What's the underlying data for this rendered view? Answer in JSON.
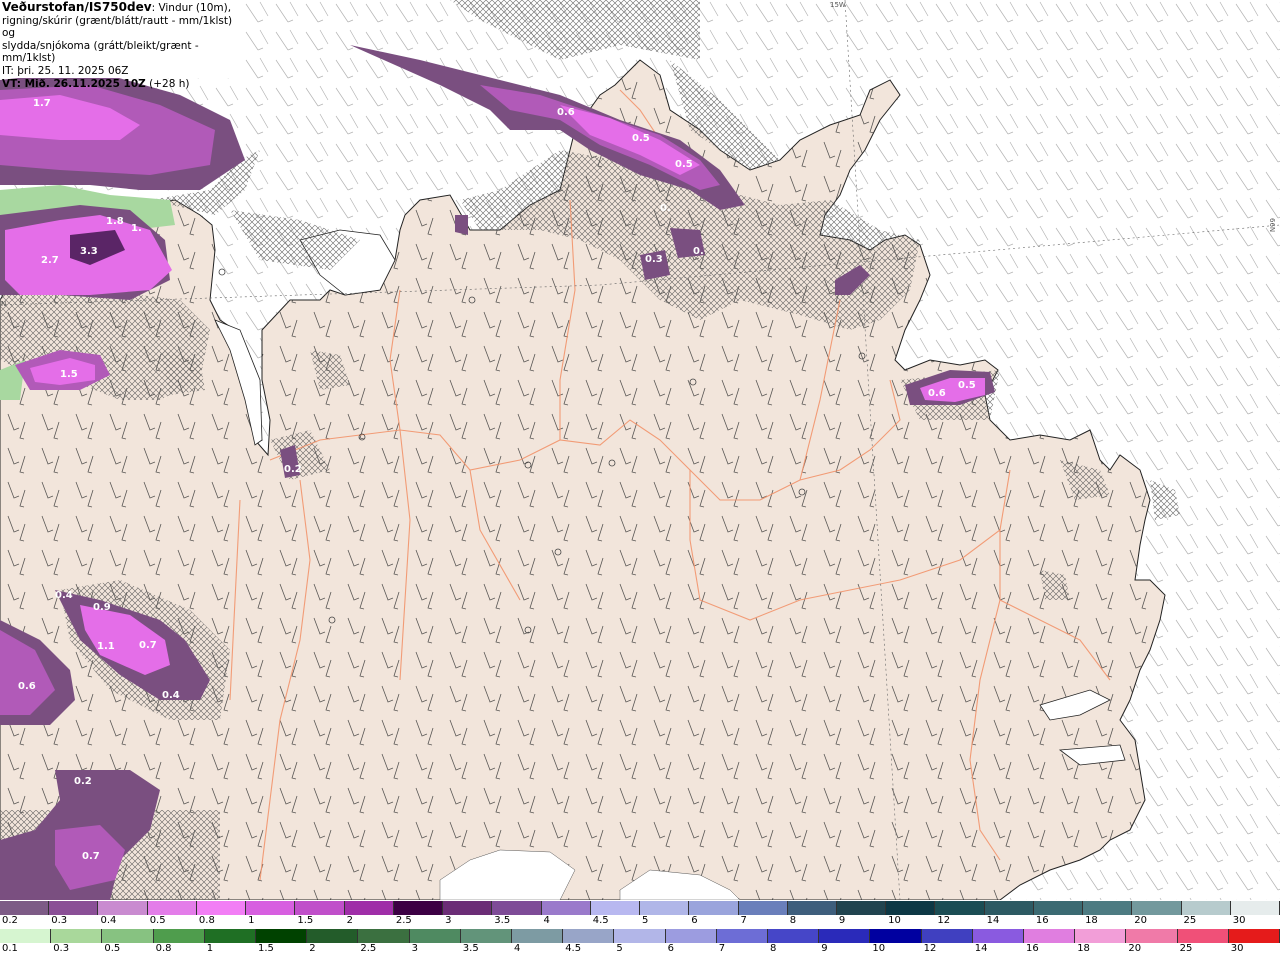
{
  "header": {
    "title": "Veðurstofan/IS750dev",
    "desc1": ": Vindur (10m),",
    "desc2": "rigning/skúrir (grænt/blátt/rautt - mm/1klst) og",
    "desc3": "slydda/snjókoma (grátt/bleikt/grænt - mm/1klst)",
    "it_line": "IT: þri. 25. 11. 2025 06Z",
    "vt_label": "VT: Mið. 26.11.2025 10Z",
    "vt_offset": " (+28 h)"
  },
  "grid_labels": {
    "lon": "15W",
    "lat": "66N",
    "lat_left": "N"
  },
  "precip_labels": [
    "1.7",
    "3.3",
    "2.7",
    "1.8",
    "1.",
    "1.5",
    "0.6",
    "0.5",
    "0.5",
    "0.3",
    "0.",
    "0.",
    "0.6",
    "0.5",
    "0.2",
    "0.4",
    "0.9",
    "1.1",
    "0.7",
    "0.4",
    "0.6",
    "0.2",
    "0.7"
  ],
  "colors": {
    "land": "#f2e5db",
    "sea": "#ffffff",
    "roads": "#f2936b",
    "hatch": "#555555",
    "snow_light": "#7a4f80",
    "snow_mid": "#b15ab8",
    "snow_heavy": "#e46ee8",
    "rain_light": "#a8d8a0"
  },
  "legend_top": {
    "labels": [
      "0.2",
      "0.3",
      "0.4",
      "0.5",
      "0.8",
      "1",
      "1.5",
      "2",
      "2.5",
      "3",
      "3.5",
      "4",
      "4.5",
      "5",
      "6",
      "7",
      "8",
      "9",
      "10",
      "12",
      "14",
      "16",
      "18",
      "20",
      "25",
      "30"
    ],
    "colors": [
      "#7d5b86",
      "#8a4f96",
      "#c98bd0",
      "#e37de9",
      "#f27ef5",
      "#d75fe0",
      "#c04fca",
      "#9f2ea8",
      "#3c0044",
      "#6b2d76",
      "#7e4b97",
      "#9a7acb",
      "#b8b8f0",
      "#b0b6e8",
      "#9aa4dc",
      "#6a7fbb",
      "#3e5e7c",
      "#21444f",
      "#0d3845",
      "#1b4d54",
      "#2d5a63",
      "#3b6a72",
      "#4d7b82",
      "#73999d",
      "#b7cbcd",
      "#e6ecec"
    ]
  },
  "legend_bottom": {
    "labels": [
      "0.1",
      "0.3",
      "0.5",
      "0.8",
      "1",
      "1.5",
      "2",
      "2.5",
      "3",
      "3.5",
      "4",
      "4.5",
      "5",
      "6",
      "7",
      "8",
      "9",
      "10",
      "12",
      "14",
      "16",
      "18",
      "20",
      "25",
      "30"
    ],
    "colors": [
      "#d6f5d0",
      "#a9d89b",
      "#87c281",
      "#4f9d4d",
      "#1f6f24",
      "#004200",
      "#235c2a",
      "#3b7040",
      "#4f8a61",
      "#62947a",
      "#7d9ba3",
      "#98a5c8",
      "#b2b6e8",
      "#9c9ce0",
      "#6d6dd6",
      "#4646c8",
      "#2a2aba",
      "#0000a0",
      "#4040c0",
      "#8a5ae0",
      "#e07ee0",
      "#f29ed8",
      "#f07aa8",
      "#f05078",
      "#e51b1b"
    ]
  }
}
